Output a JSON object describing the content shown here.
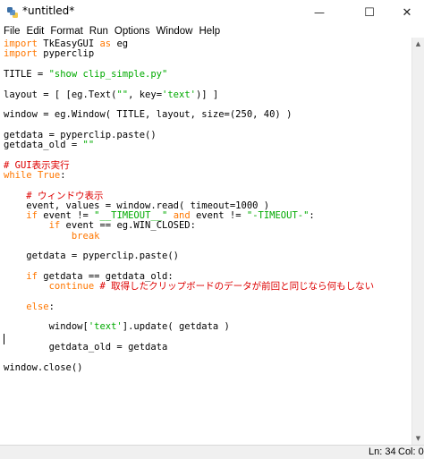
{
  "window": {
    "title": "*untitled*",
    "minimize_glyph": "—",
    "maximize_glyph": "☐",
    "close_glyph": "✕"
  },
  "menu": [
    "File",
    "Edit",
    "Format",
    "Run",
    "Options",
    "Window",
    "Help"
  ],
  "editor": {
    "lines": [
      [
        [
          "kw",
          "import"
        ],
        [
          "n",
          " TkEasyGUI "
        ],
        [
          "kw",
          "as"
        ],
        [
          "n",
          " eg"
        ]
      ],
      [
        [
          "kw",
          "import"
        ],
        [
          "n",
          " pyperclip"
        ]
      ],
      [],
      [
        [
          "n",
          "TITLE = "
        ],
        [
          "str",
          "\"show clip_simple.py\""
        ]
      ],
      [],
      [
        [
          "n",
          "layout = [ [eg.Text("
        ],
        [
          "str",
          "\"\""
        ],
        [
          "n",
          ", key="
        ],
        [
          "str",
          "'text'"
        ],
        [
          "n",
          ")] ]"
        ]
      ],
      [],
      [
        [
          "n",
          "window = eg.Window( TITLE, layout, size=(250, 40) )"
        ]
      ],
      [],
      [
        [
          "n",
          "getdata = pyperclip.paste()"
        ]
      ],
      [
        [
          "n",
          "getdata_old = "
        ],
        [
          "str",
          "\"\""
        ]
      ],
      [],
      [
        [
          "com",
          "# GUI表示実行"
        ]
      ],
      [
        [
          "kw",
          "while"
        ],
        [
          "n",
          " "
        ],
        [
          "kw",
          "True"
        ],
        [
          "n",
          ":"
        ]
      ],
      [],
      [
        [
          "n",
          "    "
        ],
        [
          "com",
          "# ウィンドウ表示"
        ]
      ],
      [
        [
          "n",
          "    event, values = window.read( timeout=1000 )"
        ]
      ],
      [
        [
          "n",
          "    "
        ],
        [
          "kw",
          "if"
        ],
        [
          "n",
          " event != "
        ],
        [
          "str",
          "\"__TIMEOUT__\""
        ],
        [
          "n",
          " "
        ],
        [
          "kw",
          "and"
        ],
        [
          "n",
          " event != "
        ],
        [
          "str",
          "\"-TIMEOUT-\""
        ],
        [
          "n",
          ":"
        ]
      ],
      [
        [
          "n",
          "        "
        ],
        [
          "kw",
          "if"
        ],
        [
          "n",
          " event == eg.WIN_CLOSED:"
        ]
      ],
      [
        [
          "n",
          "            "
        ],
        [
          "kw",
          "break"
        ]
      ],
      [],
      [
        [
          "n",
          "    getdata = pyperclip.paste()"
        ]
      ],
      [],
      [
        [
          "n",
          "    "
        ],
        [
          "kw",
          "if"
        ],
        [
          "n",
          " getdata == getdata_old:"
        ]
      ],
      [
        [
          "n",
          "        "
        ],
        [
          "kw",
          "continue"
        ],
        [
          "n",
          " "
        ],
        [
          "com",
          "# 取得したクリップボードのデータが前回と同じなら何もしない"
        ]
      ],
      [],
      [
        [
          "n",
          "    "
        ],
        [
          "kw",
          "else"
        ],
        [
          "n",
          ":"
        ]
      ],
      [],
      [
        [
          "n",
          "        window["
        ],
        [
          "str",
          "'text'"
        ],
        [
          "n",
          "].update( getdata )"
        ]
      ],
      [],
      [
        [
          "n",
          "        getdata_old = getdata"
        ]
      ],
      [],
      [
        [
          "n",
          "window.close()"
        ]
      ]
    ]
  },
  "statusbar": {
    "line": "Ln: 34",
    "col": "Col: 0"
  },
  "colors": {
    "keyword": "#ff7700",
    "string": "#00aa00",
    "comment": "#dd0000",
    "default": "#000000"
  }
}
